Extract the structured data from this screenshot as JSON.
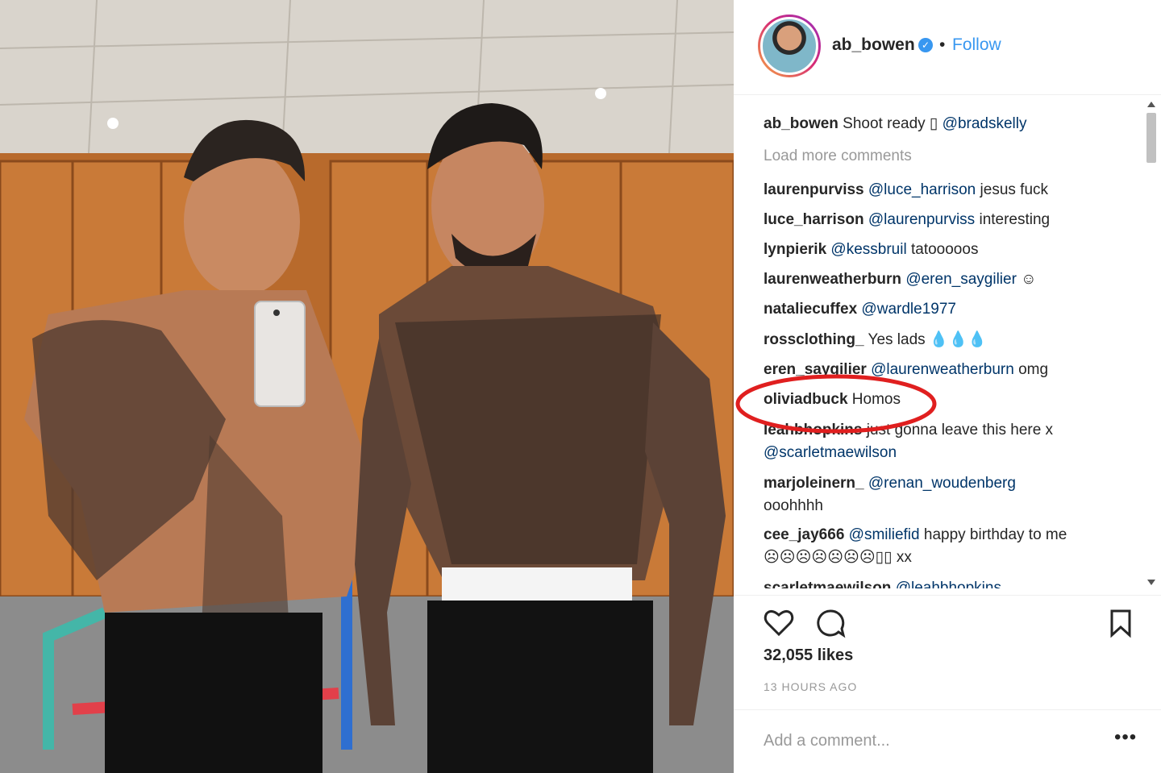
{
  "post": {
    "username": "ab_bowen",
    "follow_label": "Follow",
    "separator": "•",
    "verified_glyph": "✓"
  },
  "comments": [
    {
      "user": "ab_bowen",
      "mention": "",
      "text": " Shoot ready ▯ ",
      "text2": "@bradskelly"
    },
    {
      "load_more": "Load more comments"
    },
    {
      "user": "laurenpurviss",
      "mention": " @luce_harrison",
      "text": " jesus fuck"
    },
    {
      "user": "luce_harrison",
      "mention": " @laurenpurviss",
      "text": " interesting"
    },
    {
      "user": "lynpierik",
      "mention": " @kessbruil",
      "text": " tatooooos"
    },
    {
      "user": "laurenweatherburn",
      "mention": " @eren_saygilier",
      "text": " ☺"
    },
    {
      "user": "nataliecuffex",
      "mention": " @wardle1977",
      "text": ""
    },
    {
      "user": "rossclothing_",
      "mention": "",
      "text": " Yes lads 💧💧💧"
    },
    {
      "user": "eren_saygilier",
      "mention": " @laurenweatherburn",
      "text": " omg"
    },
    {
      "user": "oliviadbuck",
      "mention": "",
      "text": " Homos"
    },
    {
      "user": "leahbhopkins",
      "mention": "",
      "text": " just gonna leave this here x"
    },
    {
      "continuation": "@scarletmaewilson"
    },
    {
      "user": "marjoleinern_",
      "mention": " @renan_woudenberg",
      "text": ""
    },
    {
      "continuation_text": "ooohhhh"
    },
    {
      "user": "cee_jay666",
      "mention": " @smiliefid",
      "text": " happy birthday to me"
    },
    {
      "continuation_text": "☹☹☹☹☹☹☹▯▯ xx"
    },
    {
      "user": "scarletmaewilson",
      "mention": " @leahbhopkins",
      "text": ""
    }
  ],
  "stats": {
    "likes": "32,055 likes",
    "time": "13 HOURS AGO"
  },
  "add_comment": {
    "placeholder": "Add a comment...",
    "more": "•••"
  },
  "icons": [
    "heart-icon",
    "comment-icon",
    "bookmark-icon",
    "verified-icon"
  ],
  "colors": {
    "link": "#003569",
    "follow": "#3897f0",
    "highlight": "#e01f1f"
  }
}
